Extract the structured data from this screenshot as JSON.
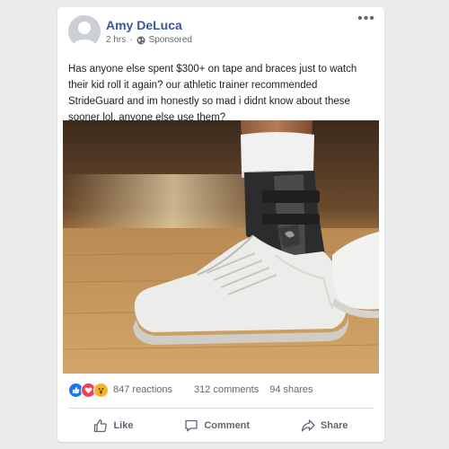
{
  "post": {
    "author": "Amy DeLuca",
    "time": "2 hrs",
    "separator": "·",
    "sponsored_label": "Sponsored",
    "more_label": "•••",
    "text": "Has anyone else spent $300+ on tape and braces just to watch their kid roll it again? our athletic trainer recommended StrideGuard and im honestly so mad i didnt know about these sooner lol. anyone else use them?"
  },
  "stats": {
    "reactions": "847 reactions",
    "comments": "312 comments",
    "shares": "94 shares",
    "reaction_icons": [
      "like-icon",
      "love-icon",
      "wow-icon"
    ]
  },
  "actions": {
    "like": "Like",
    "comment": "Comment",
    "share": "Share"
  },
  "colors": {
    "author_link": "#385898",
    "like_blue": "#1877f2",
    "love_red": "#f33e58",
    "wow_yellow": "#f7b125",
    "background": "#eaebed"
  }
}
